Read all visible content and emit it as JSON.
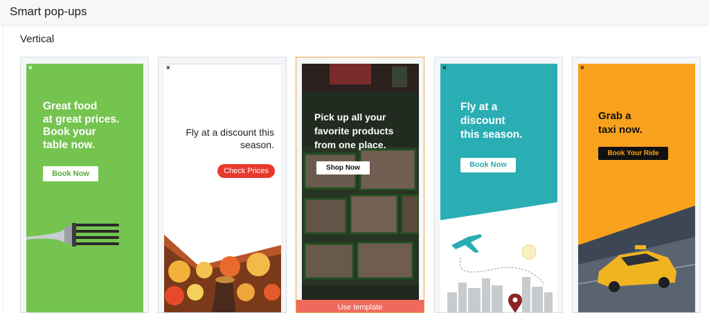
{
  "header": {
    "title": "Smart pop-ups"
  },
  "section": {
    "title": "Vertical"
  },
  "templates": [
    {
      "headline": "Great food\nat great prices.\nBook your\ntable now.",
      "cta": "Book Now",
      "close": "×"
    },
    {
      "headline": "Fly at a discount this\nseason.",
      "cta": "Check Prices",
      "close": "×"
    },
    {
      "headline": "Pick up all your\nfavorite products\nfrom one place.",
      "cta": "Shop Now",
      "hover_action": "Use template"
    },
    {
      "headline": "Fly at a\ndiscount\nthis season.",
      "cta": "Book Now",
      "close": "×"
    },
    {
      "headline": "Grab a\ntaxi now.",
      "cta": "Book Your Ride",
      "close": "×"
    }
  ],
  "colors": {
    "green": "#74c44f",
    "red": "#e8392d",
    "teal": "#2aa9ae",
    "orange": "#f8a21d",
    "hover_bar": "#f06a5c",
    "selected_border": "#f0a64a"
  },
  "icons": [
    "close-icon",
    "fork-icon",
    "airplane-icon",
    "location-pin-icon"
  ]
}
